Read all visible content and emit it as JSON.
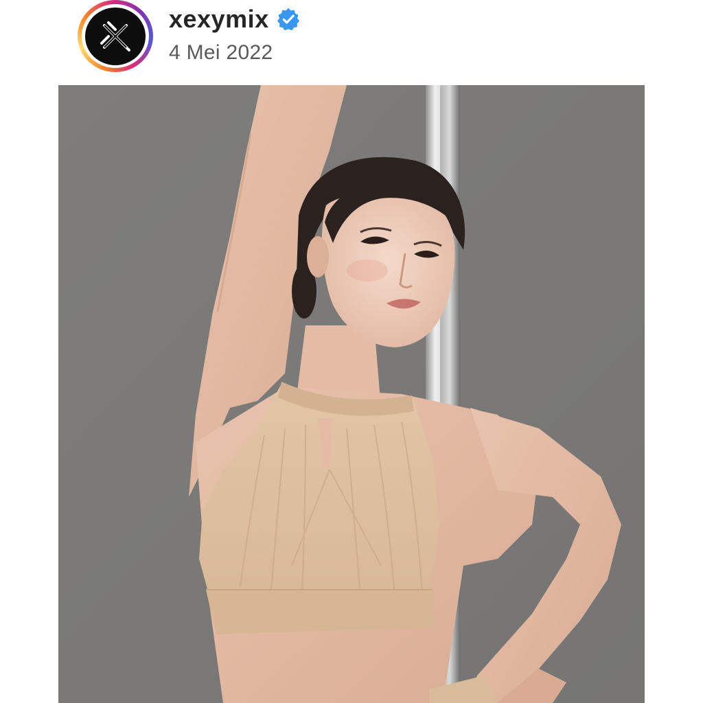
{
  "post": {
    "username": "xexymix",
    "verified": true,
    "date": "4 Mei 2022"
  },
  "icons": {
    "avatar_logo": "xexymix-logo-icon",
    "verified_badge": "verified-badge-icon"
  },
  "colors": {
    "avatar_background": "#0d0d0d",
    "verified_blue": "#3897f0",
    "username_text": "#262626",
    "date_text": "#595959",
    "photo_background": "#7b7a78"
  },
  "photo": {
    "subject": "woman in beige mesh halter sports top posing with one arm raised beside a chrome pole against a grey backdrop"
  }
}
